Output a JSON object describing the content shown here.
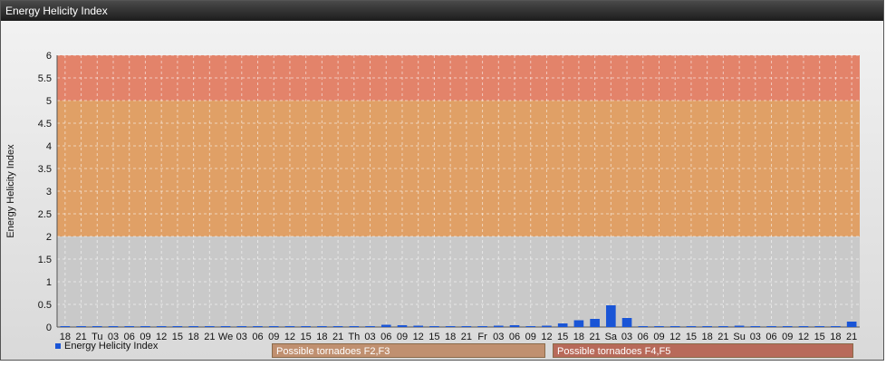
{
  "window": {
    "title": "Energy Helicity Index"
  },
  "colors": {
    "band_high": "#e3836a",
    "band_mid": "#e0a066",
    "band_low": "#c9c9c9",
    "bar": "#1a55d6",
    "zone_f23": "#c09070",
    "zone_f45": "#b86a5a"
  },
  "legend": {
    "label": "Energy Helicity Index"
  },
  "zones": [
    {
      "label": "Possible tornadoes F2,F3"
    },
    {
      "label": "Possible tornadoes F4,F5"
    }
  ],
  "chart_data": {
    "type": "bar",
    "title": "",
    "xlabel": "",
    "ylabel": "Energy Helicity Index",
    "ylim": [
      0,
      6
    ],
    "yticks": [
      "0",
      "0.5",
      "1",
      "1.5",
      "2",
      "2.5",
      "3",
      "3.5",
      "4",
      "4.5",
      "5",
      "5.5",
      "6"
    ],
    "bands": [
      {
        "from": 0,
        "to": 2,
        "color": "#c9c9c9"
      },
      {
        "from": 2,
        "to": 5,
        "color": "#e0a066"
      },
      {
        "from": 5,
        "to": 6,
        "color": "#e3836a"
      }
    ],
    "grid": true,
    "legend_position": "bottom-left",
    "categories": [
      "18",
      "21",
      "Tu",
      "03",
      "06",
      "09",
      "12",
      "15",
      "18",
      "21",
      "We",
      "03",
      "06",
      "09",
      "12",
      "15",
      "18",
      "21",
      "Th",
      "03",
      "06",
      "09",
      "12",
      "15",
      "18",
      "21",
      "Fr",
      "03",
      "06",
      "09",
      "12",
      "15",
      "18",
      "21",
      "Sa",
      "03",
      "06",
      "09",
      "12",
      "15",
      "18",
      "21",
      "Su",
      "03",
      "06",
      "09",
      "12",
      "15",
      "18",
      "21"
    ],
    "series": [
      {
        "name": "Energy Helicity Index",
        "values": [
          0.01,
          0.01,
          0.01,
          0.01,
          0.02,
          0.01,
          0.01,
          0.01,
          0.01,
          0.01,
          0.01,
          0.01,
          0.02,
          0.01,
          0.02,
          0.01,
          0.01,
          0.01,
          0.01,
          0.02,
          0.05,
          0.04,
          0.03,
          0.02,
          0.01,
          0.02,
          0.02,
          0.03,
          0.04,
          0.02,
          0.03,
          0.08,
          0.15,
          0.18,
          0.48,
          0.2,
          0.01,
          0.01,
          0.01,
          0.01,
          0.02,
          0.02,
          0.03,
          0.01,
          0.01,
          0.01,
          0.01,
          0.01,
          0.02,
          0.12
        ]
      }
    ]
  }
}
